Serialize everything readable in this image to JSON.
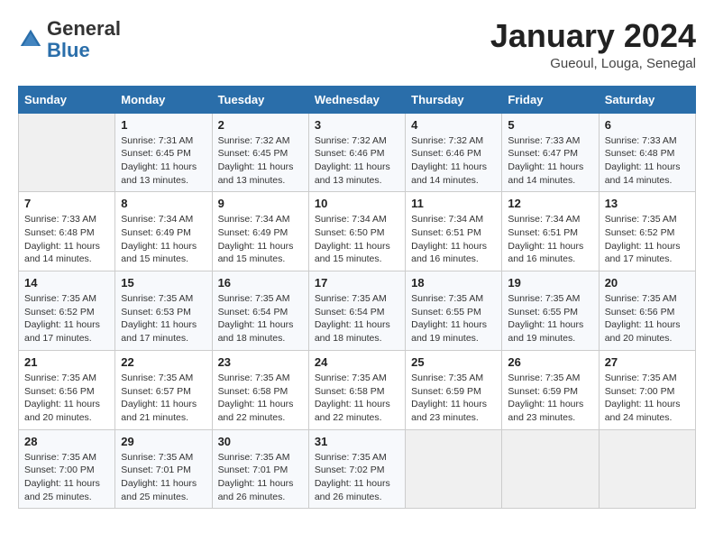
{
  "header": {
    "logo_general": "General",
    "logo_blue": "Blue",
    "month_title": "January 2024",
    "location": "Gueoul, Louga, Senegal"
  },
  "days_header": [
    "Sunday",
    "Monday",
    "Tuesday",
    "Wednesday",
    "Thursday",
    "Friday",
    "Saturday"
  ],
  "weeks": [
    [
      {
        "day": "",
        "empty": true
      },
      {
        "day": "1",
        "sunrise": "7:31 AM",
        "sunset": "6:45 PM",
        "daylight": "11 hours and 13 minutes."
      },
      {
        "day": "2",
        "sunrise": "7:32 AM",
        "sunset": "6:45 PM",
        "daylight": "11 hours and 13 minutes."
      },
      {
        "day": "3",
        "sunrise": "7:32 AM",
        "sunset": "6:46 PM",
        "daylight": "11 hours and 13 minutes."
      },
      {
        "day": "4",
        "sunrise": "7:32 AM",
        "sunset": "6:46 PM",
        "daylight": "11 hours and 14 minutes."
      },
      {
        "day": "5",
        "sunrise": "7:33 AM",
        "sunset": "6:47 PM",
        "daylight": "11 hours and 14 minutes."
      },
      {
        "day": "6",
        "sunrise": "7:33 AM",
        "sunset": "6:48 PM",
        "daylight": "11 hours and 14 minutes."
      }
    ],
    [
      {
        "day": "7",
        "sunrise": "7:33 AM",
        "sunset": "6:48 PM",
        "daylight": "11 hours and 14 minutes."
      },
      {
        "day": "8",
        "sunrise": "7:34 AM",
        "sunset": "6:49 PM",
        "daylight": "11 hours and 15 minutes."
      },
      {
        "day": "9",
        "sunrise": "7:34 AM",
        "sunset": "6:49 PM",
        "daylight": "11 hours and 15 minutes."
      },
      {
        "day": "10",
        "sunrise": "7:34 AM",
        "sunset": "6:50 PM",
        "daylight": "11 hours and 15 minutes."
      },
      {
        "day": "11",
        "sunrise": "7:34 AM",
        "sunset": "6:51 PM",
        "daylight": "11 hours and 16 minutes."
      },
      {
        "day": "12",
        "sunrise": "7:34 AM",
        "sunset": "6:51 PM",
        "daylight": "11 hours and 16 minutes."
      },
      {
        "day": "13",
        "sunrise": "7:35 AM",
        "sunset": "6:52 PM",
        "daylight": "11 hours and 17 minutes."
      }
    ],
    [
      {
        "day": "14",
        "sunrise": "7:35 AM",
        "sunset": "6:52 PM",
        "daylight": "11 hours and 17 minutes."
      },
      {
        "day": "15",
        "sunrise": "7:35 AM",
        "sunset": "6:53 PM",
        "daylight": "11 hours and 17 minutes."
      },
      {
        "day": "16",
        "sunrise": "7:35 AM",
        "sunset": "6:54 PM",
        "daylight": "11 hours and 18 minutes."
      },
      {
        "day": "17",
        "sunrise": "7:35 AM",
        "sunset": "6:54 PM",
        "daylight": "11 hours and 18 minutes."
      },
      {
        "day": "18",
        "sunrise": "7:35 AM",
        "sunset": "6:55 PM",
        "daylight": "11 hours and 19 minutes."
      },
      {
        "day": "19",
        "sunrise": "7:35 AM",
        "sunset": "6:55 PM",
        "daylight": "11 hours and 19 minutes."
      },
      {
        "day": "20",
        "sunrise": "7:35 AM",
        "sunset": "6:56 PM",
        "daylight": "11 hours and 20 minutes."
      }
    ],
    [
      {
        "day": "21",
        "sunrise": "7:35 AM",
        "sunset": "6:56 PM",
        "daylight": "11 hours and 20 minutes."
      },
      {
        "day": "22",
        "sunrise": "7:35 AM",
        "sunset": "6:57 PM",
        "daylight": "11 hours and 21 minutes."
      },
      {
        "day": "23",
        "sunrise": "7:35 AM",
        "sunset": "6:58 PM",
        "daylight": "11 hours and 22 minutes."
      },
      {
        "day": "24",
        "sunrise": "7:35 AM",
        "sunset": "6:58 PM",
        "daylight": "11 hours and 22 minutes."
      },
      {
        "day": "25",
        "sunrise": "7:35 AM",
        "sunset": "6:59 PM",
        "daylight": "11 hours and 23 minutes."
      },
      {
        "day": "26",
        "sunrise": "7:35 AM",
        "sunset": "6:59 PM",
        "daylight": "11 hours and 23 minutes."
      },
      {
        "day": "27",
        "sunrise": "7:35 AM",
        "sunset": "7:00 PM",
        "daylight": "11 hours and 24 minutes."
      }
    ],
    [
      {
        "day": "28",
        "sunrise": "7:35 AM",
        "sunset": "7:00 PM",
        "daylight": "11 hours and 25 minutes."
      },
      {
        "day": "29",
        "sunrise": "7:35 AM",
        "sunset": "7:01 PM",
        "daylight": "11 hours and 25 minutes."
      },
      {
        "day": "30",
        "sunrise": "7:35 AM",
        "sunset": "7:01 PM",
        "daylight": "11 hours and 26 minutes."
      },
      {
        "day": "31",
        "sunrise": "7:35 AM",
        "sunset": "7:02 PM",
        "daylight": "11 hours and 26 minutes."
      },
      {
        "day": "",
        "empty": true
      },
      {
        "day": "",
        "empty": true
      },
      {
        "day": "",
        "empty": true
      }
    ]
  ],
  "labels": {
    "sunrise": "Sunrise:",
    "sunset": "Sunset:",
    "daylight": "Daylight:"
  }
}
